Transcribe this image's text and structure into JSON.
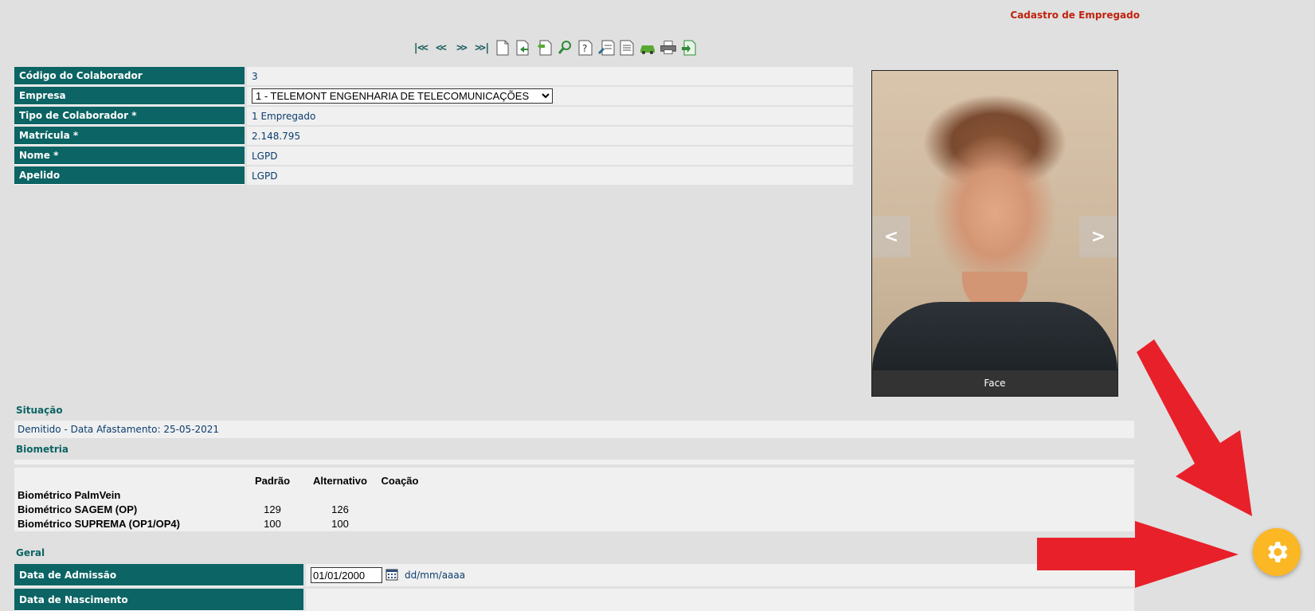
{
  "header": {
    "title": "Cadastro de Empregado"
  },
  "toolbar": {
    "nav": [
      "|<<",
      "<<",
      ">>",
      ">>|"
    ],
    "icons": [
      "new-document-icon",
      "save-icon",
      "undo-icon",
      "search-icon",
      "help-icon",
      "edit-icon",
      "report-icon",
      "car-icon",
      "printer-icon",
      "export-icon"
    ]
  },
  "fields": [
    {
      "label": "Código do Colaborador",
      "value": "3"
    },
    {
      "label": "Empresa",
      "value": "1 - TELEMONT ENGENHARIA DE TELECOMUNICAÇÕES"
    },
    {
      "label": "Tipo de Colaborador *",
      "value": "1 Empregado"
    },
    {
      "label": "Matrícula *",
      "value": "2.148.795"
    },
    {
      "label": "Nome *",
      "value": "LGPD"
    },
    {
      "label": "Apelido",
      "value": "LGPD"
    }
  ],
  "photo": {
    "caption": "Face",
    "prev": "<",
    "next": ">"
  },
  "situacao": {
    "title": "Situação",
    "text": "Demitido - Data Afastamento: 25-05-2021"
  },
  "biometria": {
    "title": "Biometria",
    "columns": [
      "Padrão",
      "Alternativo",
      "Coação"
    ],
    "rows": [
      {
        "name": "Biométrico PalmVein",
        "padrao": "",
        "alternativo": "",
        "coacao": ""
      },
      {
        "name": "Biométrico SAGEM (OP)",
        "padrao": "129",
        "alternativo": "126",
        "coacao": ""
      },
      {
        "name": "Biométrico SUPREMA (OP1/OP4)",
        "padrao": "100",
        "alternativo": "100",
        "coacao": ""
      }
    ]
  },
  "geral": {
    "title": "Geral",
    "admissao": {
      "label": "Data de Admissão",
      "value": "01/01/2000",
      "hint": "dd/mm/aaaa"
    },
    "nascimento": {
      "label": "Data de Nascimento"
    }
  },
  "colors": {
    "label_bg": "#0c6464",
    "title_red": "#c0220e",
    "gear": "#fbb724",
    "arrow": "#e8202a"
  }
}
